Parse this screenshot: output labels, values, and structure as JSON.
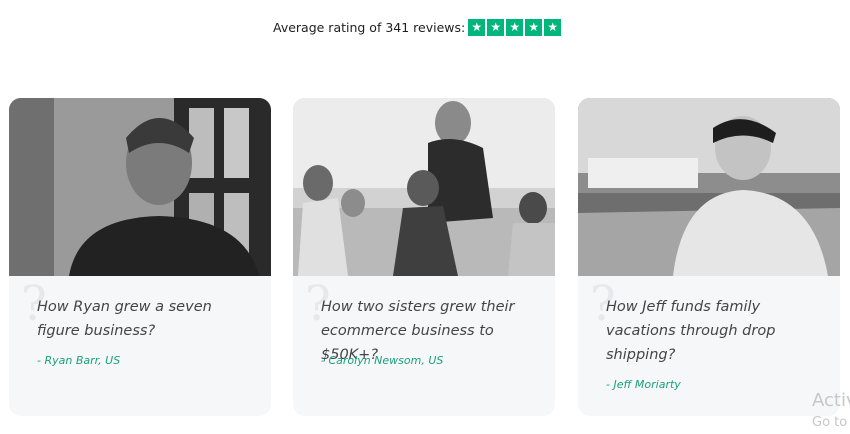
{
  "rating": {
    "text": "Average rating of 341 reviews:",
    "stars": 5
  },
  "cards": [
    {
      "title": "How Ryan grew a seven figure business?",
      "author": "- Ryan Barr, US"
    },
    {
      "title": "How two sisters grew their ecommerce business to $50K+?",
      "author": "- Carolyn Newsom, US"
    },
    {
      "title": "How Jeff funds family vacations through drop shipping?",
      "author": "- Jeff Moriarty"
    }
  ],
  "watermark": {
    "line1": "Activ",
    "line2": "Go to"
  },
  "colors": {
    "star_green": "#00b67a",
    "author_green": "#1aa07a",
    "card_bg": "#f6f7f9"
  }
}
